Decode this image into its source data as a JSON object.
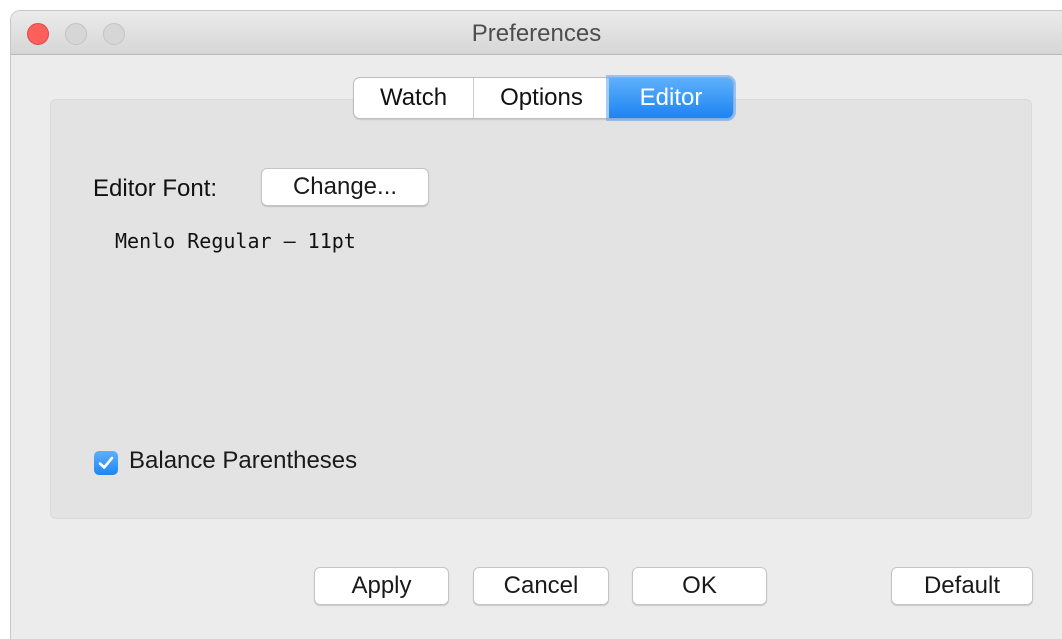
{
  "window": {
    "title": "Preferences"
  },
  "tabs": [
    {
      "label": "Watch",
      "selected": false
    },
    {
      "label": "Options",
      "selected": false
    },
    {
      "label": "Editor",
      "selected": true
    }
  ],
  "editor": {
    "font_label": "Editor Font:",
    "change_button": "Change...",
    "font_value": "Menlo Regular – 11pt",
    "balance_parentheses": {
      "label": "Balance Parentheses",
      "checked": true
    }
  },
  "buttons": {
    "apply": "Apply",
    "cancel": "Cancel",
    "ok": "OK",
    "default": "Default"
  },
  "colors": {
    "accent": "#1d84f2",
    "close_light": "#fc605b"
  }
}
